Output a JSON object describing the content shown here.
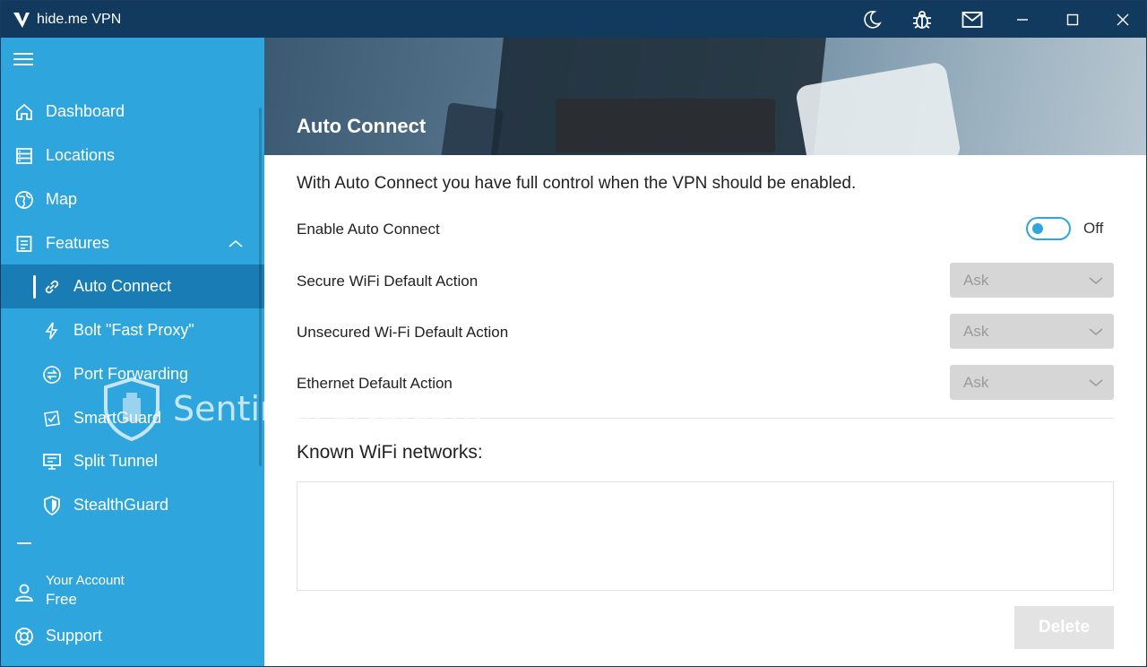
{
  "titlebar": {
    "title": "hide.me VPN"
  },
  "sidebar": {
    "items": [
      {
        "label": "Dashboard",
        "icon": "home-icon"
      },
      {
        "label": "Locations",
        "icon": "server-list-icon"
      },
      {
        "label": "Map",
        "icon": "globe-icon"
      },
      {
        "label": "Features",
        "icon": "document-icon"
      }
    ],
    "features": [
      {
        "label": "Auto Connect",
        "icon": "link-icon",
        "active": true
      },
      {
        "label": "Bolt \"Fast Proxy\"",
        "icon": "bolt-icon"
      },
      {
        "label": "Port Forwarding",
        "icon": "port-forward-icon"
      },
      {
        "label": "SmartGuard",
        "icon": "smartguard-icon"
      },
      {
        "label": "Split Tunnel",
        "icon": "monitor-icon"
      },
      {
        "label": "StealthGuard",
        "icon": "shield-icon"
      }
    ],
    "account": {
      "label": "Your Account",
      "plan": "Free"
    },
    "support": "Support"
  },
  "watermark": {
    "text": "SentinelForte.com"
  },
  "main": {
    "header_title": "Auto Connect",
    "description": "With Auto Connect you have full control when the VPN should be enabled.",
    "enable_label": "Enable Auto Connect",
    "enable_state": "Off",
    "rows": [
      {
        "label": "Secure WiFi Default Action",
        "value": "Ask"
      },
      {
        "label": "Unsecured Wi-Fi Default Action",
        "value": "Ask"
      },
      {
        "label": "Ethernet Default Action",
        "value": "Ask"
      }
    ],
    "known_title": "Known WiFi networks:",
    "delete_label": "Delete"
  },
  "colors": {
    "sidebar": "#2fa5dd",
    "sidebar_active": "#1a7cb4",
    "titlebar": "#123a5e"
  }
}
